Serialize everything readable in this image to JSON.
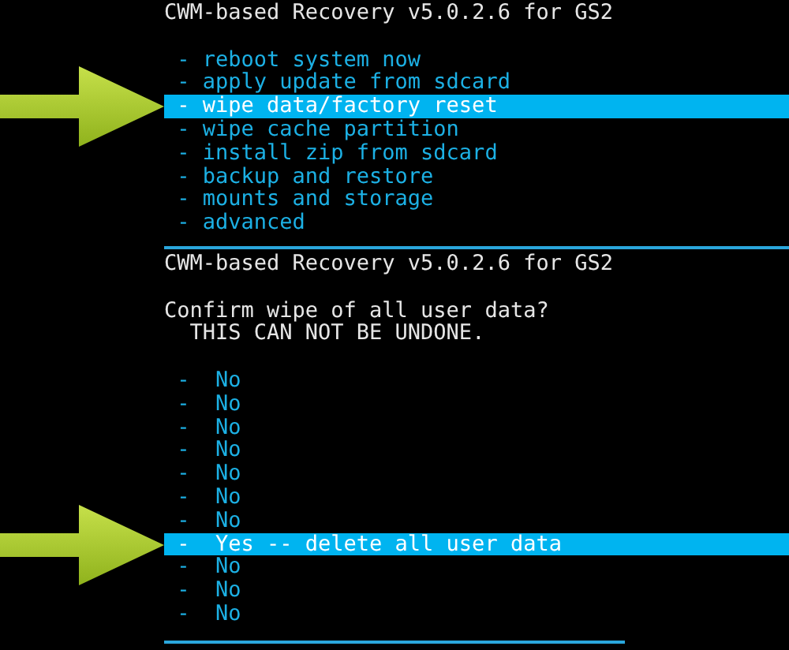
{
  "panels": [
    {
      "title": "CWM-based Recovery v5.0.2.6 for GS2",
      "items": [
        {
          "label": "- reboot system now",
          "selected": false
        },
        {
          "label": "- apply update from sdcard",
          "selected": false
        },
        {
          "label": "- wipe data/factory reset",
          "selected": true
        },
        {
          "label": "- wipe cache partition",
          "selected": false
        },
        {
          "label": "- install zip from sdcard",
          "selected": false
        },
        {
          "label": "- backup and restore",
          "selected": false
        },
        {
          "label": "- mounts and storage",
          "selected": false
        },
        {
          "label": "- advanced",
          "selected": false
        }
      ]
    },
    {
      "title": "CWM-based Recovery v5.0.2.6 for GS2",
      "prompt": [
        "Confirm wipe of all user data?",
        "  THIS CAN NOT BE UNDONE."
      ],
      "items": [
        {
          "label": "-  No",
          "selected": false
        },
        {
          "label": "-  No",
          "selected": false
        },
        {
          "label": "-  No",
          "selected": false
        },
        {
          "label": "-  No",
          "selected": false
        },
        {
          "label": "-  No",
          "selected": false
        },
        {
          "label": "-  No",
          "selected": false
        },
        {
          "label": "-  No",
          "selected": false
        },
        {
          "label": "-  Yes -- delete all user data",
          "selected": true
        },
        {
          "label": "-  No",
          "selected": false
        },
        {
          "label": "-  No",
          "selected": false
        },
        {
          "label": "-  No",
          "selected": false
        }
      ]
    }
  ]
}
